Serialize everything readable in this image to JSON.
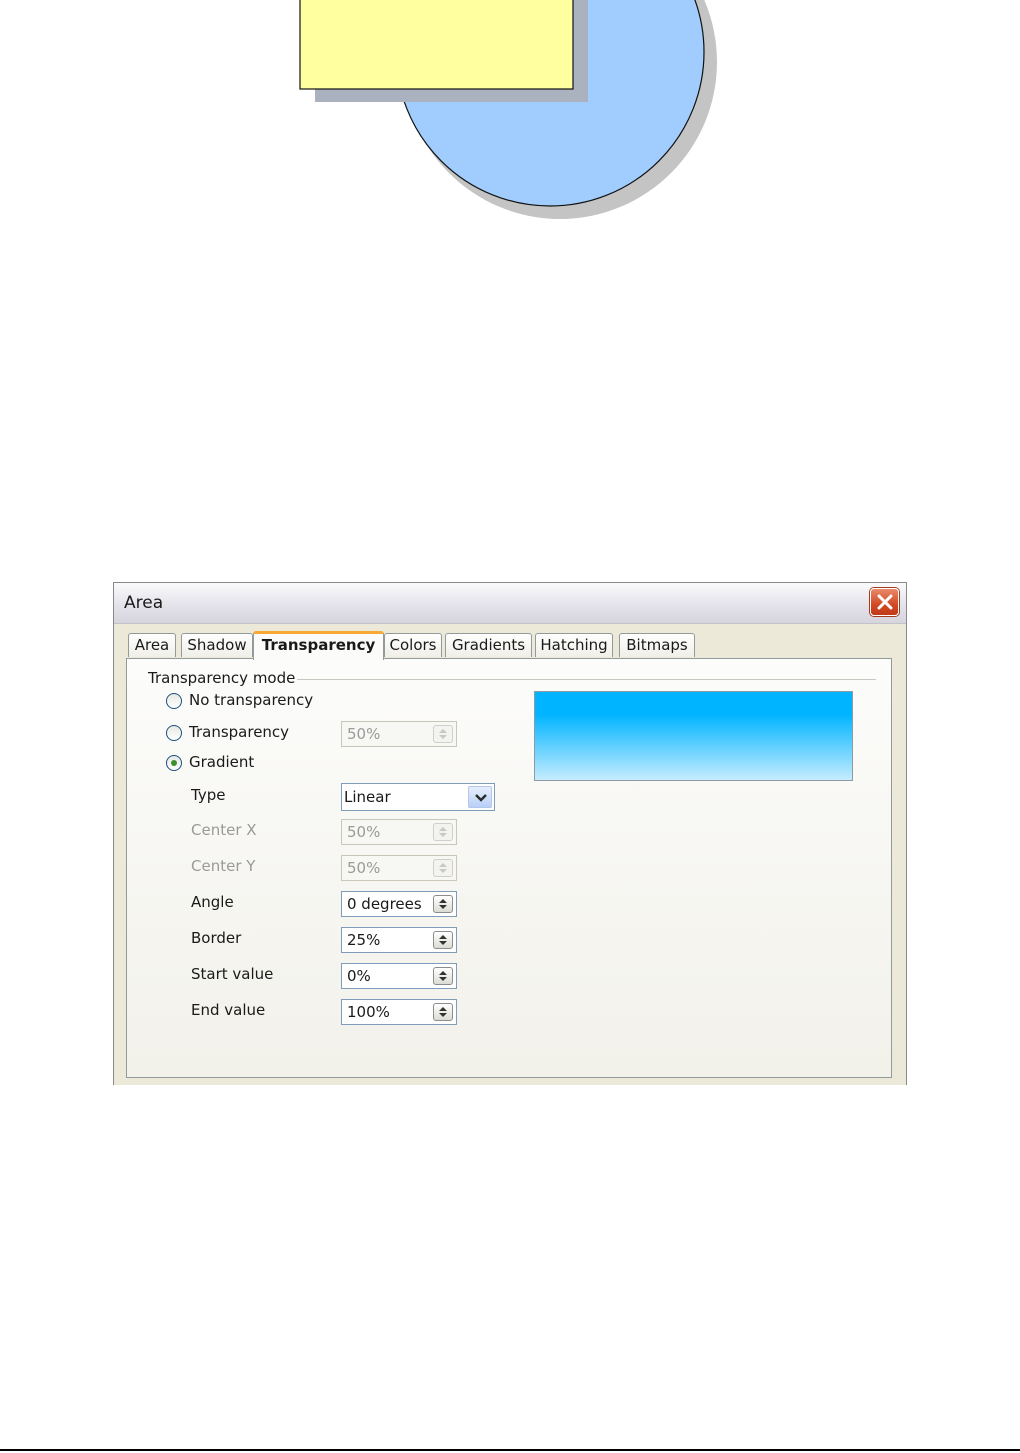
{
  "dialog": {
    "title": "Area",
    "tabs": [
      {
        "label": "Area"
      },
      {
        "label": "Shadow"
      },
      {
        "label": "Transparency",
        "active": true
      },
      {
        "label": "Colors"
      },
      {
        "label": "Gradients"
      },
      {
        "label": "Hatching"
      },
      {
        "label": "Bitmaps"
      }
    ],
    "group_label": "Transparency mode",
    "modes": {
      "no_transparency": {
        "label": "No transparency",
        "selected": false
      },
      "transparency": {
        "label": "Transparency",
        "selected": false,
        "value": "50%"
      },
      "gradient": {
        "label": "Gradient",
        "selected": true
      }
    },
    "fields": {
      "type": {
        "label": "Type",
        "value": "Linear"
      },
      "center_x": {
        "label": "Center X",
        "value": "50%",
        "enabled": false
      },
      "center_y": {
        "label": "Center Y",
        "value": "50%",
        "enabled": false
      },
      "angle": {
        "label": "Angle",
        "value": "0 degrees"
      },
      "border": {
        "label": "Border",
        "value": "25%"
      },
      "start_value": {
        "label": "Start value",
        "value": "0%"
      },
      "end_value": {
        "label": "End value",
        "value": "100%"
      }
    },
    "preview": {
      "gradient_top": "#00b4ff",
      "gradient_bottom": "#c6ecff"
    }
  },
  "illustration": {
    "rectangle_color": "#ffff99",
    "circle_color": "#99ccff",
    "shadow_color": "#c0c0c0"
  }
}
